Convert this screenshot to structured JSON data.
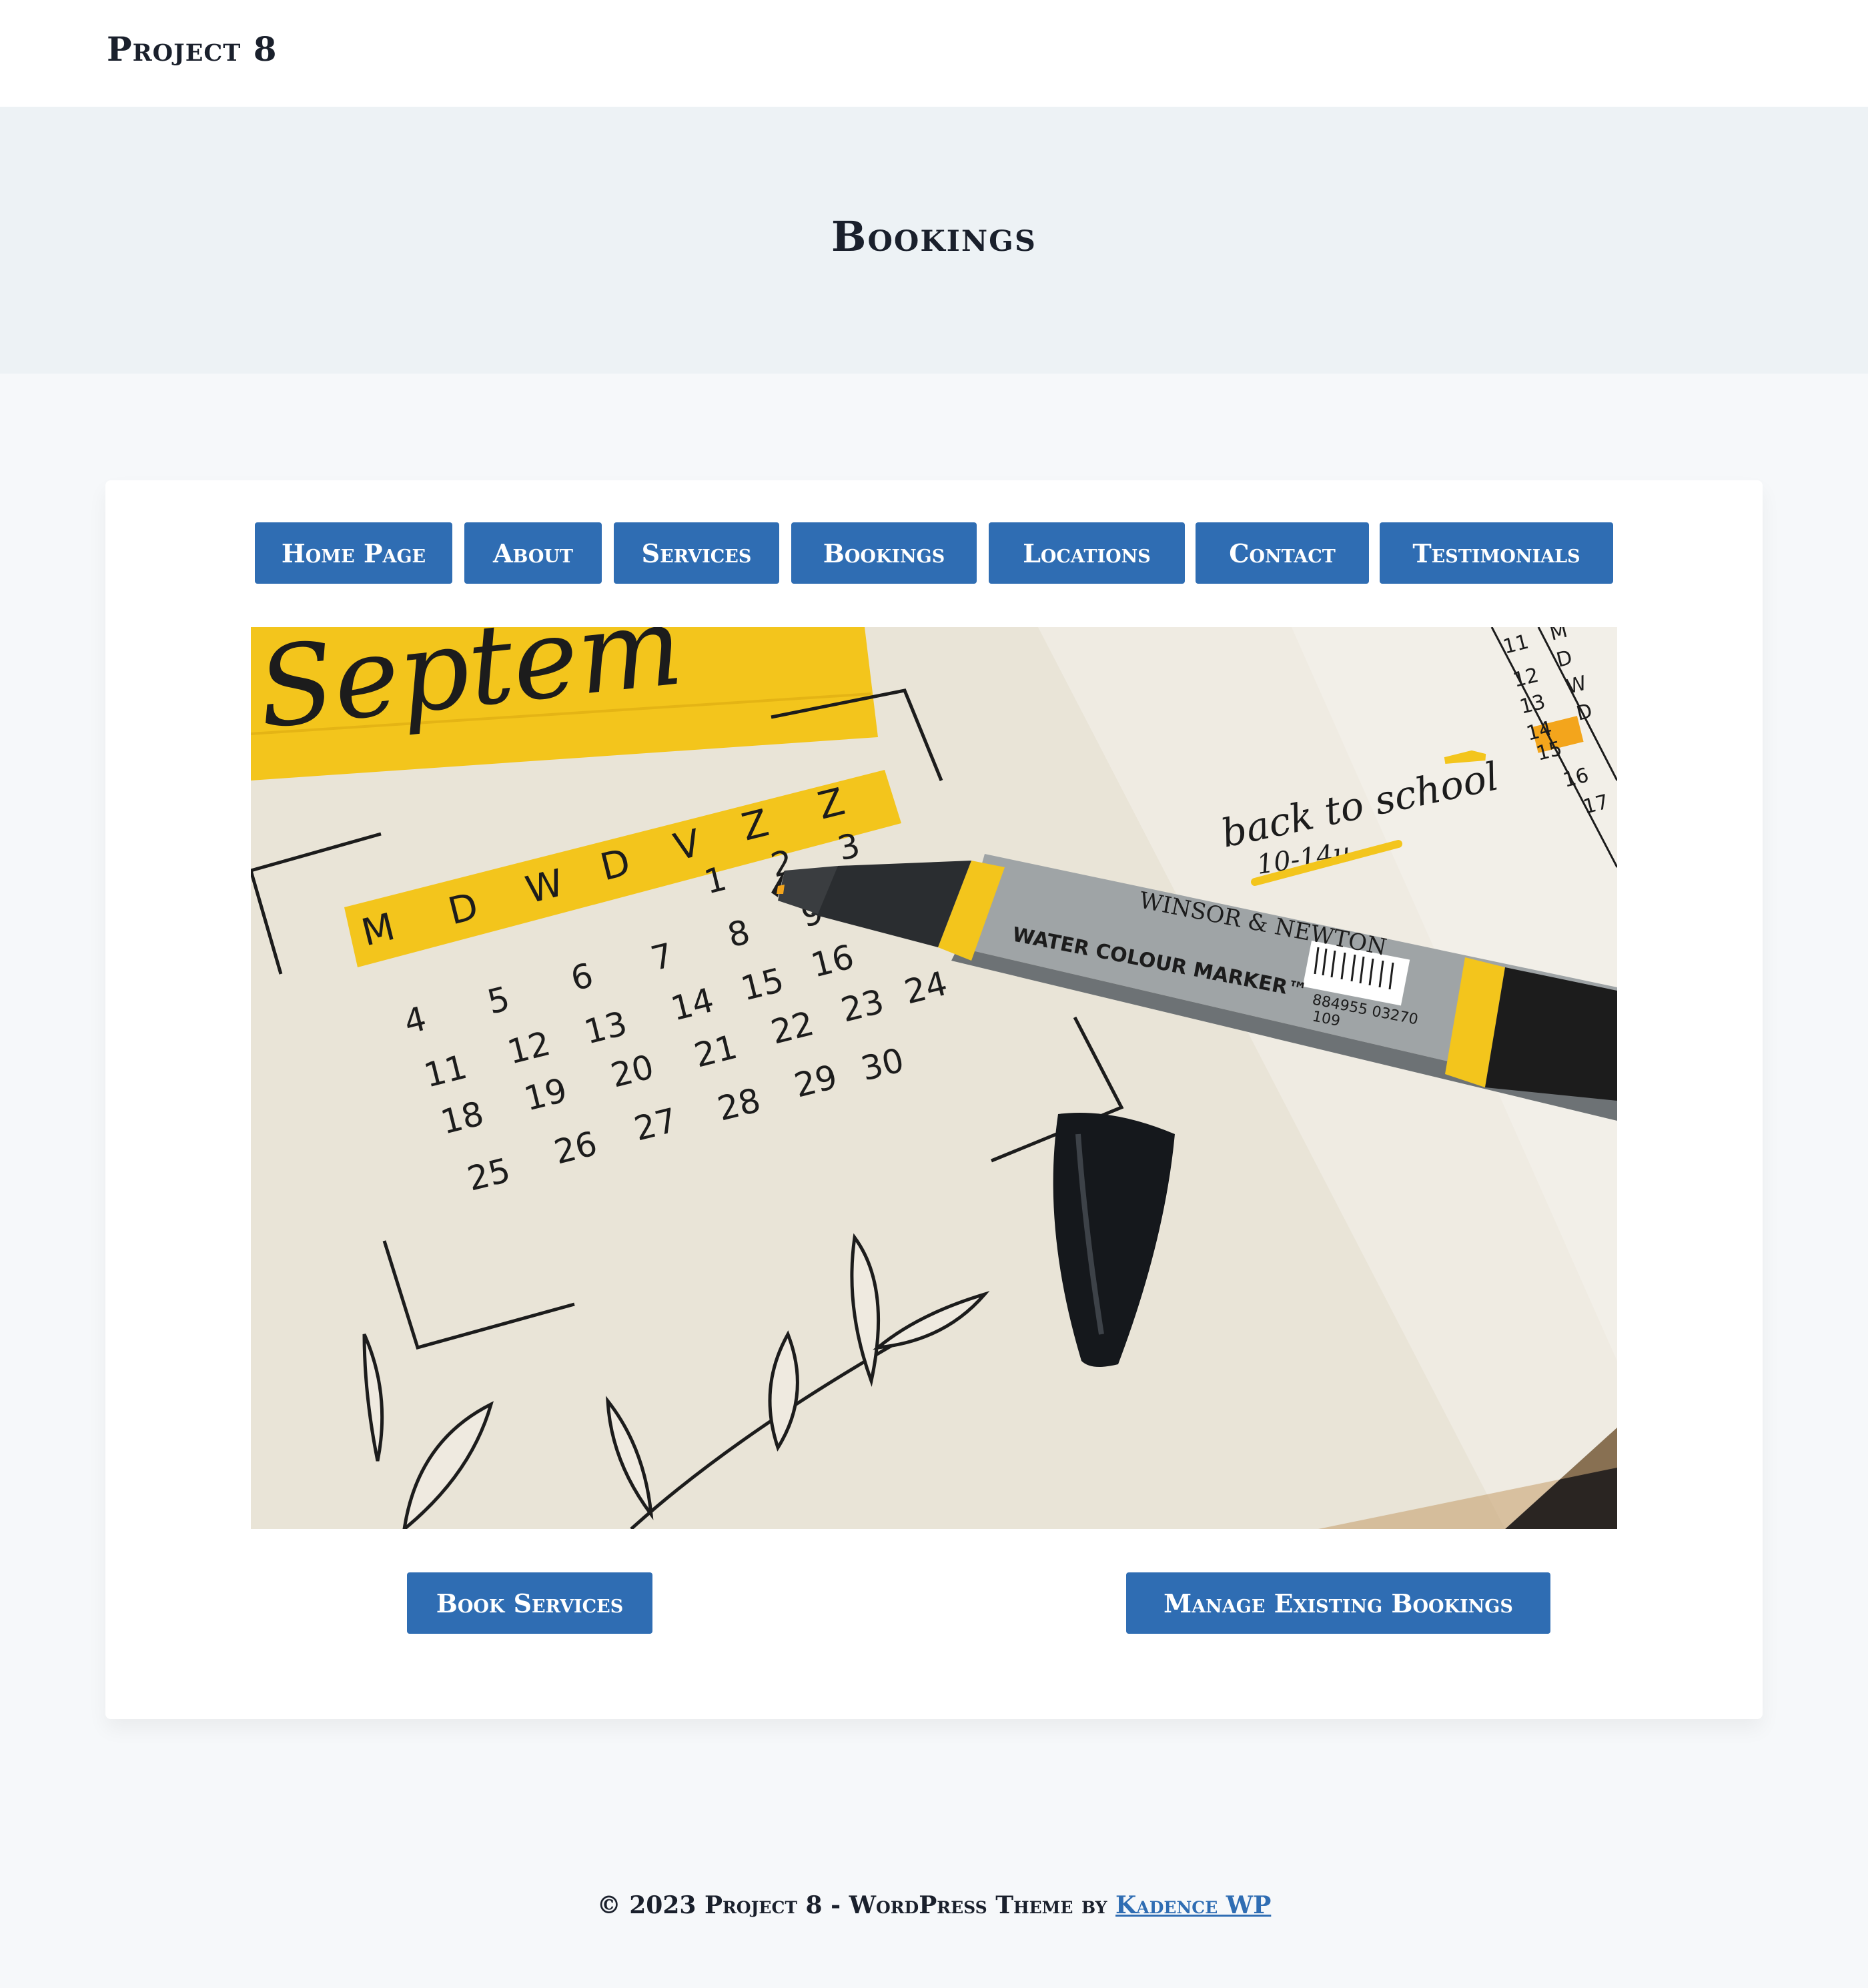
{
  "site": {
    "title": "Project 8"
  },
  "hero": {
    "title": "Bookings"
  },
  "nav": {
    "items": [
      {
        "label": "Home Page"
      },
      {
        "label": "About"
      },
      {
        "label": "Services"
      },
      {
        "label": "Bookings"
      },
      {
        "label": "Locations"
      },
      {
        "label": "Contact"
      },
      {
        "label": "Testimonials"
      }
    ]
  },
  "image": {
    "title_text": "Septem",
    "weekdays": [
      "M",
      "D",
      "W",
      "D",
      "V",
      "Z",
      "Z"
    ],
    "days": [
      "1",
      "2",
      "3",
      "4",
      "5",
      "6",
      "7",
      "8",
      "9",
      "11",
      "12",
      "13",
      "14",
      "15",
      "16",
      "18",
      "19",
      "20",
      "21",
      "22",
      "23",
      "24",
      "25",
      "26",
      "27",
      "28",
      "29",
      "30"
    ],
    "note_main": "back to school",
    "note_sub": "10-14u",
    "side_list": [
      "11",
      "12",
      "13",
      "14",
      "15",
      "16",
      "17"
    ],
    "side_letters": [
      "M",
      "D",
      "W",
      "D"
    ],
    "marker_brand": "WINSOR & NEWTON",
    "marker_label": "WATER COLOUR MARKER™",
    "marker_barcode": "884955 03270",
    "marker_code": "109",
    "colors": {
      "highlight": "#f3c51c",
      "marker_body": "#9fa4a6",
      "ink": "#1c1c1c"
    }
  },
  "actions": {
    "book": "Book Services",
    "manage": "Manage Existing Bookings"
  },
  "footer": {
    "text": "© 2023 Project 8 - WordPress Theme by ",
    "link": "Kadence WP"
  },
  "colors": {
    "accent": "#2f6db3",
    "header_bg": "#ffffff",
    "hero_bg": "#edf2f5",
    "page_bg": "#f6f8fa"
  }
}
